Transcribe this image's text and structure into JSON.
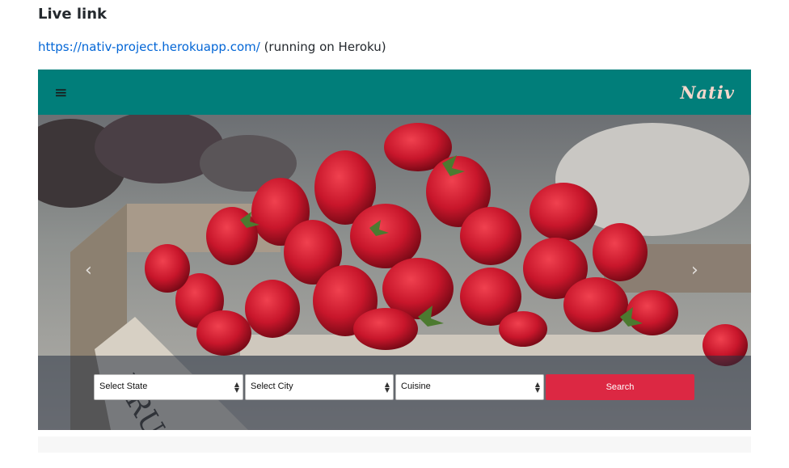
{
  "readme": {
    "heading": "Live link",
    "link_url": "https://nativ-project.herokuapp.com/",
    "link_text": "https://nativ-project.herokuapp.com/",
    "link_suffix": " (running on Heroku)"
  },
  "app": {
    "navbar": {
      "menu_icon": "hamburger-icon",
      "menu_glyph": "≡",
      "brand": "Nativ",
      "bg_color": "#017e7a"
    },
    "carousel": {
      "prev_icon": "chevron-left-icon",
      "prev_glyph": "‹",
      "next_icon": "chevron-right-icon",
      "next_glyph": "›"
    },
    "search": {
      "state_value": "Select State",
      "city_value": "Select City",
      "cuisine_value": "Cuisine",
      "button_label": "Search",
      "button_color": "#dc2843"
    }
  }
}
